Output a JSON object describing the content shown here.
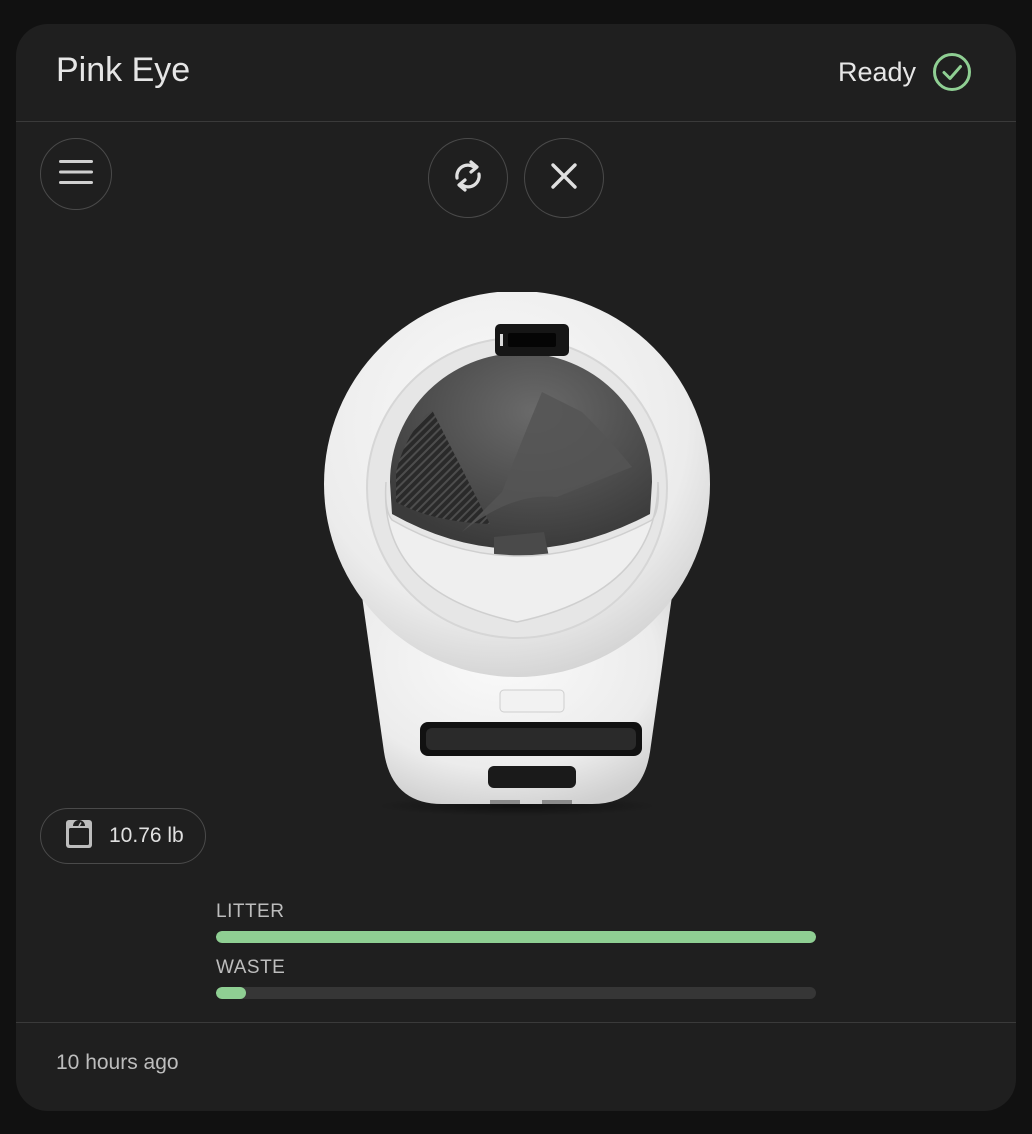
{
  "header": {
    "title": "Pink Eye",
    "status": "Ready",
    "status_color": "#8fcf93"
  },
  "controls": {
    "menu_icon": "hamburger-menu-icon",
    "refresh_icon": "refresh-icon",
    "close_icon": "close-icon"
  },
  "device": {
    "image": "litter-robot-image",
    "weight": "10.76 lb",
    "weight_icon": "scale-icon"
  },
  "gauges": {
    "litter": {
      "label": "LITTER",
      "level_percent": 100
    },
    "waste": {
      "label": "WASTE",
      "level_percent": 5
    }
  },
  "footer": {
    "last_updated": "10 hours ago"
  }
}
